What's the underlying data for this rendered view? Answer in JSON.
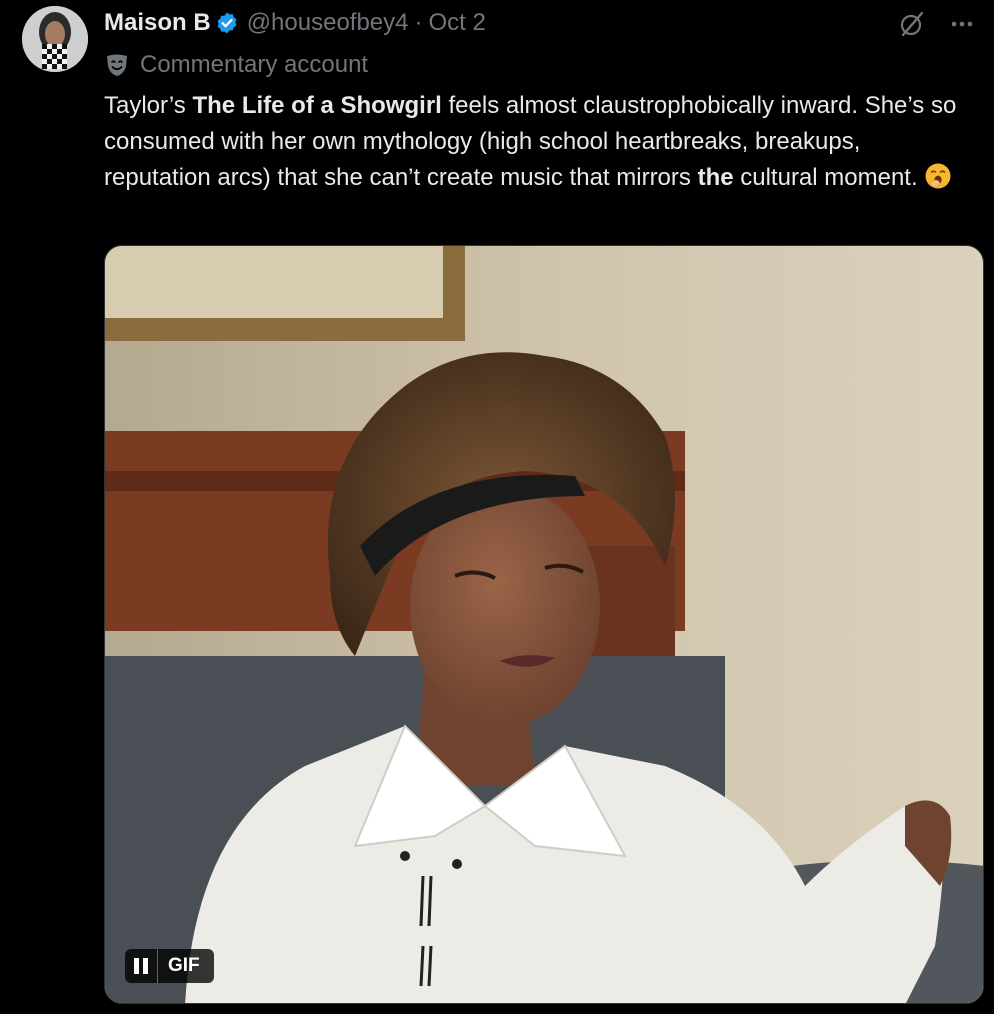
{
  "post": {
    "author": {
      "name": "Maison B",
      "handle": "@houseofbey4",
      "separator": "·",
      "date": "Oct 2",
      "verified": true
    },
    "label": {
      "icon": "theater-mask-icon",
      "text": "Commentary account"
    },
    "text": {
      "p1": "Taylor’s ",
      "b1": "The Life of a Showgirl",
      "p2": " feels almost claustrophobically inward. She’s so consumed with her own mythology (high school heartbreaks, breakups, reputation arcs) that she can’t create music that mirrors ",
      "b2": "the",
      "p3": " cultural moment.",
      "emoji": "yawning-face-emoji"
    },
    "media": {
      "type": "GIF",
      "badge": "GIF",
      "control": "pause-icon"
    },
    "actions": {
      "grok": "grok-icon",
      "more": "more-icon"
    }
  },
  "colors": {
    "background": "#000000",
    "primary_text": "#e7e9ea",
    "secondary_text": "#71767b",
    "verified_blue": "#1d9bf0",
    "border": "#2f3336"
  }
}
